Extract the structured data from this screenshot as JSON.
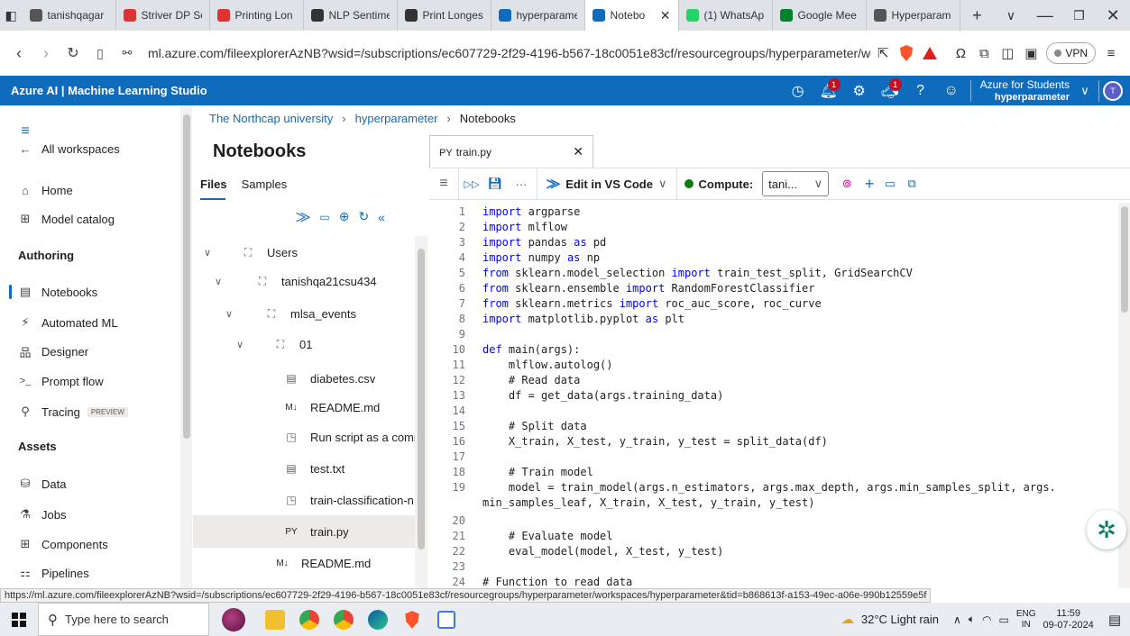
{
  "browser": {
    "tabs": [
      {
        "title": "tanishqagar",
        "fav_color": "#555"
      },
      {
        "title": "Striver DP Se",
        "fav_color": "#d33"
      },
      {
        "title": "Printing Lon",
        "fav_color": "#d33"
      },
      {
        "title": "NLP Sentime",
        "fav_color": "#333"
      },
      {
        "title": "Print Longes",
        "fav_color": "#333"
      },
      {
        "title": "hyperparame",
        "fav_color": "#0f6cbd"
      },
      {
        "title": "Notebo",
        "fav_color": "#0f6cbd"
      },
      {
        "title": "(1) WhatsAp",
        "fav_color": "#25d366"
      },
      {
        "title": "Google Mee",
        "fav_color": "#00832d"
      },
      {
        "title": "Hyperparam",
        "fav_color": "#555"
      }
    ],
    "active_tab_index": 6,
    "url": "ml.azure.com/fileexplorerAzNB?wsid=/subscriptions/ec607729-2f29-4196-b567-18c0051e83cf/resourcegroups/hyperparameter/works...",
    "vpn_label": "VPN"
  },
  "azure": {
    "title": "Azure AI | Machine Learning Studio",
    "notification_count": "1",
    "feedback_count": "1",
    "subscription": "Azure for Students",
    "workspace": "hyperparameter",
    "avatar_initial": "T"
  },
  "leftnav": {
    "all_workspaces": "All workspaces",
    "home": "Home",
    "model_catalog": "Model catalog",
    "authoring_head": "Authoring",
    "notebooks": "Notebooks",
    "automated_ml": "Automated ML",
    "designer": "Designer",
    "prompt_flow": "Prompt flow",
    "tracing": "Tracing",
    "tracing_badge": "PREVIEW",
    "assets_head": "Assets",
    "data": "Data",
    "jobs": "Jobs",
    "components": "Components",
    "pipelines": "Pipelines"
  },
  "breadcrumb": {
    "org": "The Northcap university",
    "workspace": "hyperparameter",
    "current": "Notebooks"
  },
  "files": {
    "title": "Notebooks",
    "tab_files": "Files",
    "tab_samples": "Samples",
    "tree": [
      {
        "label": "Users",
        "icon": "folder-icon",
        "chev": "∨"
      },
      {
        "label": "tanishqa21csu434",
        "icon": "folder-icon",
        "chev": "∨"
      },
      {
        "label": "mlsa_events",
        "icon": "folder-icon",
        "chev": "∨"
      },
      {
        "label": "01",
        "icon": "folder-icon",
        "chev": "∨"
      },
      {
        "label": "diabetes.csv",
        "icon": "file-icon",
        "chev": ""
      },
      {
        "label": "README.md",
        "icon": "markdown-icon",
        "chev": ""
      },
      {
        "label": "Run script as a comr",
        "icon": "script-icon",
        "chev": ""
      },
      {
        "label": "test.txt",
        "icon": "file-icon",
        "chev": ""
      },
      {
        "label": "train-classification-n",
        "icon": "script-icon",
        "chev": ""
      },
      {
        "label": "train.py",
        "icon": "python-icon",
        "chev": ""
      },
      {
        "label": "README.md",
        "icon": "markdown-icon",
        "chev": ""
      }
    ],
    "selected_index": 9
  },
  "editor": {
    "tab_title": "train.py",
    "tab_icon_text": "PY",
    "edit_vscode": "Edit in VS Code",
    "compute_label": "Compute:",
    "compute_value": "tani...",
    "compute_status_color": "#107c10",
    "lines": [
      {
        "n": "1",
        "t": "import argparse"
      },
      {
        "n": "2",
        "t": "import mlflow"
      },
      {
        "n": "3",
        "t": "import pandas as pd"
      },
      {
        "n": "4",
        "t": "import numpy as np"
      },
      {
        "n": "5",
        "t": "from sklearn.model_selection import train_test_split, GridSearchCV"
      },
      {
        "n": "6",
        "t": "from sklearn.ensemble import RandomForestClassifier"
      },
      {
        "n": "7",
        "t": "from sklearn.metrics import roc_auc_score, roc_curve"
      },
      {
        "n": "8",
        "t": "import matplotlib.pyplot as plt"
      },
      {
        "n": "9",
        "t": ""
      },
      {
        "n": "10",
        "t": "def main(args):"
      },
      {
        "n": "11",
        "t": "    mlflow.autolog()"
      },
      {
        "n": "12",
        "t": "    # Read data"
      },
      {
        "n": "13",
        "t": "    df = get_data(args.training_data)"
      },
      {
        "n": "14",
        "t": ""
      },
      {
        "n": "15",
        "t": "    # Split data"
      },
      {
        "n": "16",
        "t": "    X_train, X_test, y_train, y_test = split_data(df)"
      },
      {
        "n": "17",
        "t": ""
      },
      {
        "n": "18",
        "t": "    # Train model"
      },
      {
        "n": "19",
        "t": "    model = train_model(args.n_estimators, args.max_depth, args.min_samples_split, args."
      },
      {
        "n": "",
        "t": "min_samples_leaf, X_train, X_test, y_train, y_test)"
      },
      {
        "n": "20",
        "t": ""
      },
      {
        "n": "21",
        "t": "    # Evaluate model"
      },
      {
        "n": "22",
        "t": "    eval_model(model, X_test, y_test)"
      },
      {
        "n": "23",
        "t": ""
      },
      {
        "n": "24",
        "t": "# Function to read data"
      }
    ]
  },
  "status_link": "https://ml.azure.com/fileexplorerAzNB?wsid=/subscriptions/ec607729-2f29-4196-b567-18c0051e83cf/resourcegroups/hyperparameter/workspaces/hyperparameter&tid=b868613f-a153-49ec-a06e-990b12559e5f",
  "taskbar": {
    "search_placeholder": "Type here to search",
    "weather": "32°C  Light rain",
    "lang": "ENG",
    "region": "IN",
    "time": "11:59",
    "date": "09-07-2024"
  }
}
